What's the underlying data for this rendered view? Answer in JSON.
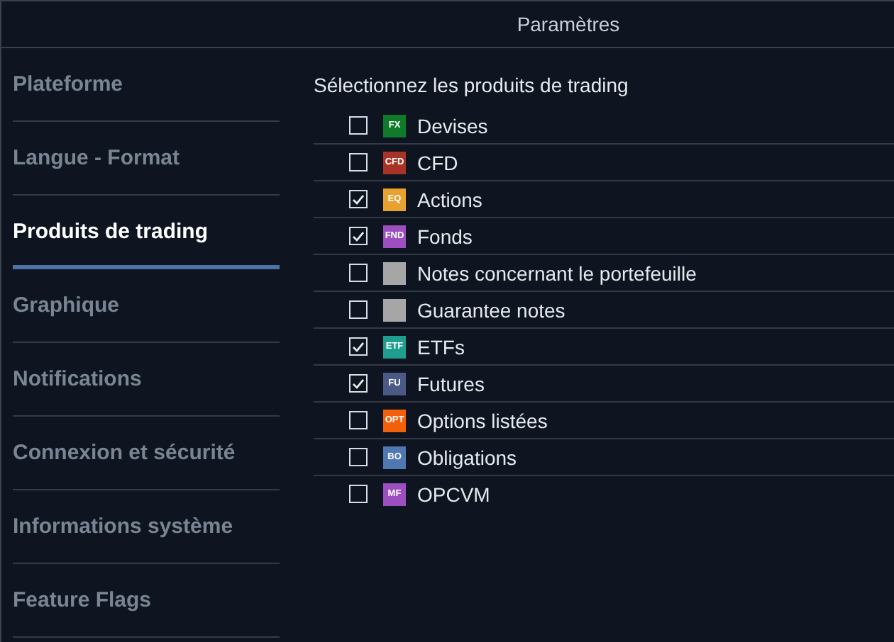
{
  "window": {
    "title": "Paramètres"
  },
  "sidebar": {
    "items": [
      {
        "label": "Plateforme",
        "selected": false
      },
      {
        "label": "Langue - Format",
        "selected": false
      },
      {
        "label": "Produits de trading",
        "selected": true
      },
      {
        "label": "Graphique",
        "selected": false
      },
      {
        "label": "Notifications",
        "selected": false
      },
      {
        "label": "Connexion et sécurité",
        "selected": false
      },
      {
        "label": "Informations système",
        "selected": false
      },
      {
        "label": "Feature Flags",
        "selected": false
      }
    ]
  },
  "products": {
    "heading": "Sélectionnez les produits de trading",
    "items": [
      {
        "label": "Devises",
        "checked": false,
        "badge": "FX",
        "color": "#0e7a2a"
      },
      {
        "label": "CFD",
        "checked": false,
        "badge": "CFD",
        "color": "#a83226"
      },
      {
        "label": "Actions",
        "checked": true,
        "badge": "EQ",
        "color": "#e8a02e"
      },
      {
        "label": "Fonds",
        "checked": true,
        "badge": "FND",
        "color": "#9c4fbf"
      },
      {
        "label": "Notes concernant le portefeuille",
        "checked": false,
        "color": "#a6a6a6"
      },
      {
        "label": "Guarantee notes",
        "checked": false,
        "color": "#a6a6a6"
      },
      {
        "label": "ETFs",
        "checked": true,
        "badge": "ETF",
        "color": "#1e9e8e"
      },
      {
        "label": "Futures",
        "checked": true,
        "badge": "FU",
        "color": "#4a5a86"
      },
      {
        "label": "Options listées",
        "checked": false,
        "badge": "OPT",
        "color": "#f2600c"
      },
      {
        "label": "Obligations",
        "checked": false,
        "badge": "BO",
        "color": "#4f78b0"
      },
      {
        "label": "OPCVM",
        "checked": false,
        "badge": "MF",
        "color": "#9c4fbf"
      }
    ]
  }
}
